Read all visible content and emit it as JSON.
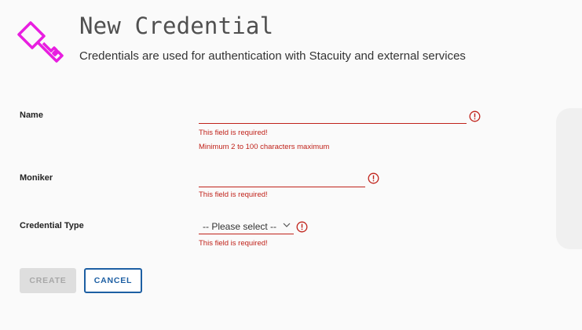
{
  "header": {
    "title": "New Credential",
    "subtitle": "Credentials are used for authentication with Stacuity and external services",
    "icon": "key-icon",
    "icon_color": "#e81ee0"
  },
  "form": {
    "name": {
      "label": "Name",
      "value": "",
      "errors": [
        "This field is required!",
        "Minimum 2 to 100 characters maximum"
      ]
    },
    "moniker": {
      "label": "Moniker",
      "value": "",
      "errors": [
        "This field is required!"
      ]
    },
    "credential_type": {
      "label": "Credential Type",
      "selected": "-- Please select --",
      "errors": [
        "This field is required!"
      ]
    }
  },
  "actions": {
    "create_label": "CREATE",
    "cancel_label": "CANCEL"
  },
  "colors": {
    "error": "#c0221a",
    "accent": "#1d5fa3",
    "brand": "#e81ee0"
  }
}
